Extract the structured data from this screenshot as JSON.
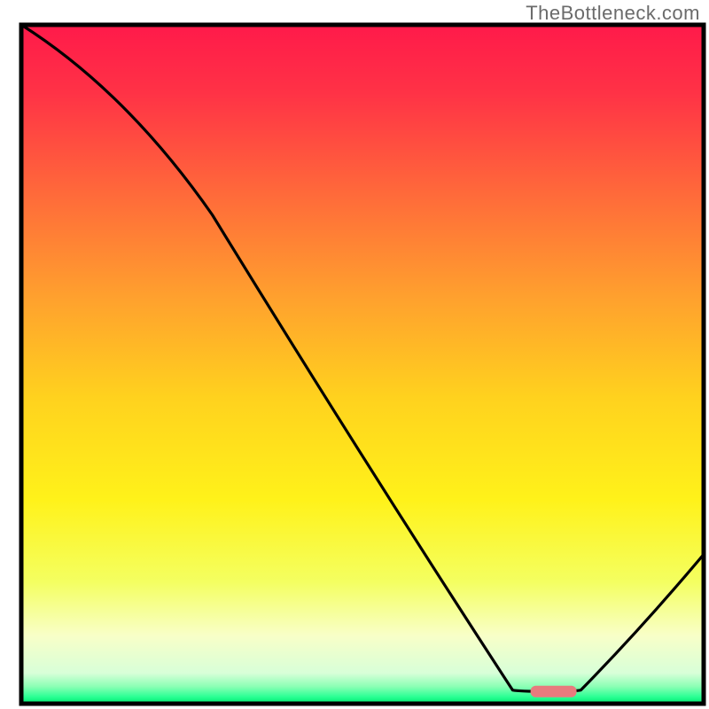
{
  "watermark": "TheBottleneck.com",
  "chart_data": {
    "type": "line",
    "title": "",
    "xlabel": "",
    "ylabel": "",
    "xlim": [
      0,
      100
    ],
    "ylim": [
      0,
      100
    ],
    "series": [
      {
        "name": "curve",
        "x": [
          0,
          28,
          72,
          82,
          100
        ],
        "y": [
          100,
          72,
          2,
          2,
          22
        ]
      }
    ],
    "marker": {
      "x": 78,
      "y": 1.8,
      "color": "#e77b7e"
    },
    "gradient_stops": [
      {
        "offset": 0,
        "color": "#ff1a4a"
      },
      {
        "offset": 0.1,
        "color": "#ff3246"
      },
      {
        "offset": 0.25,
        "color": "#ff6a3a"
      },
      {
        "offset": 0.4,
        "color": "#ffa02e"
      },
      {
        "offset": 0.55,
        "color": "#ffd21e"
      },
      {
        "offset": 0.7,
        "color": "#fff21a"
      },
      {
        "offset": 0.82,
        "color": "#f4ff60"
      },
      {
        "offset": 0.9,
        "color": "#f8ffc8"
      },
      {
        "offset": 0.955,
        "color": "#d8ffd8"
      },
      {
        "offset": 0.975,
        "color": "#8affb4"
      },
      {
        "offset": 0.99,
        "color": "#2aff94"
      },
      {
        "offset": 1.0,
        "color": "#00e870"
      }
    ]
  }
}
